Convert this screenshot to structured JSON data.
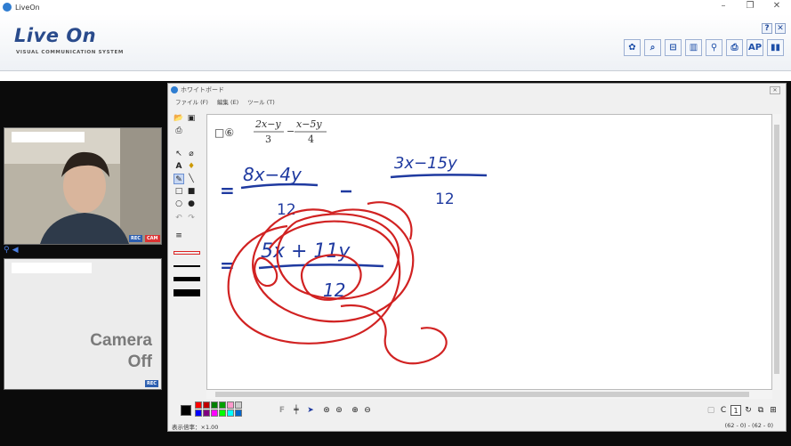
{
  "window": {
    "title": "LiveOn",
    "minimize": "–",
    "restore": "❐",
    "close": "✕"
  },
  "header": {
    "logo": "Live On",
    "logo_sub": "VISUAL COMMUNICATION SYSTEM",
    "help": "?",
    "close": "✕",
    "toolbar_icons": [
      "gear-icon",
      "search-icon",
      "bookmark-icon",
      "chart-icon",
      "zoom-icon",
      "document-icon",
      "ap-icon",
      "bars-icon"
    ],
    "toolbar_labels": [
      "✿",
      "⌕",
      "⊟",
      "▥",
      "⚲",
      "⎙",
      "AP",
      "▮▮"
    ]
  },
  "video1": {
    "badge_rec": "REC",
    "badge_cam": "CAM"
  },
  "video2": {
    "cam_off_1": "Camera",
    "cam_off_2": "Off",
    "badge_rec": "REC"
  },
  "whiteboard": {
    "title": "ホワイトボード",
    "menu": [
      "ファイル (F)",
      "編集 (E)",
      "ツール (T)"
    ],
    "problem_number": "□⑥",
    "expr_a_num": "2x−y",
    "expr_a_den": "3",
    "minus": "−",
    "expr_b_num": "x−5y",
    "expr_b_den": "4",
    "hand_line1_num": "8x−4y",
    "hand_line1_den": "12",
    "hand_line1_num2": "3x−15y",
    "hand_line1_den2": "12",
    "hand_line2_num": "5x + 11y",
    "hand_line2_den": "12",
    "eq1": "=",
    "eq2": "=",
    "zoom_label": "表示倍率：×1.00",
    "coords": "(62 - 0) - (62 - 0)",
    "page_number": "1"
  },
  "colors": {
    "accent": "#2a4b8c",
    "ink_blue": "#1f3aa0",
    "ink_red": "#d12222",
    "palette": [
      "#ff0000",
      "#c00000",
      "#008000",
      "#00a000",
      "#ff99cc",
      "#cccccc",
      "#0000ff",
      "#800080",
      "#ff00ff",
      "#00ff00",
      "#00ffff",
      "#0066cc"
    ]
  }
}
